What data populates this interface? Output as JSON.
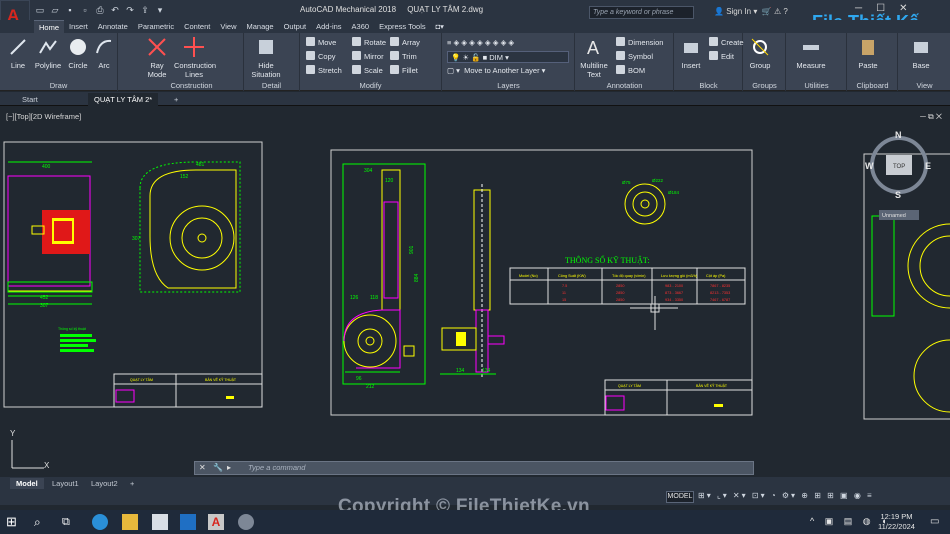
{
  "app": {
    "title": "AutoCAD Mechanical 2018",
    "file": "QUẠT LY TÂM 2.dwg",
    "search_placeholder": "Type a keyword or phrase",
    "signin": "Sign In",
    "brand": "File Thiết Kế .vn"
  },
  "ribbon_tabs": [
    "Home",
    "Insert",
    "Annotate",
    "Parametric",
    "Content",
    "View",
    "Manage",
    "Output",
    "Add-ins",
    "A360",
    "Express Tools"
  ],
  "ribbon": {
    "draw": {
      "label": "Draw",
      "line": "Line",
      "polyline": "Polyline",
      "circle": "Circle",
      "arc": "Arc"
    },
    "construction": {
      "label": "Construction",
      "ray_mode": "Ray Mode",
      "construction_lines": "Construction Lines"
    },
    "detail": {
      "label": "Detail",
      "hide_situation": "Hide Situation"
    },
    "modify": {
      "label": "Modify",
      "move": "Move",
      "rotate": "Rotate",
      "array": "Array",
      "copy": "Copy",
      "mirror": "Mirror",
      "trim": "Trim",
      "stretch": "Stretch",
      "scale": "Scale",
      "fillet": "Fillet"
    },
    "layers": {
      "label": "Layers",
      "current_layer": "DIM",
      "move_to_layer": "Move to Another Layer"
    },
    "annotation": {
      "label": "Annotation",
      "multiline_text": "Multiline Text",
      "dimension": "Dimension",
      "symbol": "Symbol",
      "bom": "BOM"
    },
    "block": {
      "label": "Block",
      "insert": "Insert",
      "create": "Create",
      "edit": "Edit"
    },
    "groups": {
      "label": "Groups",
      "group": "Group"
    },
    "utilities": {
      "label": "Utilities",
      "measure": "Measure"
    },
    "clipboard": {
      "label": "Clipboard",
      "paste": "Paste"
    },
    "view": {
      "label": "View",
      "base": "Base"
    }
  },
  "doc_tabs": [
    "Start",
    "QUẠT LY TÂM 2*",
    "+"
  ],
  "viewport": {
    "label": "[−][Top][2D Wireframe]",
    "compass": {
      "n": "N",
      "s": "S",
      "e": "E",
      "w": "W",
      "top": "TOP"
    },
    "ucs_name": "Unnamed"
  },
  "drawing": {
    "spec_title": "THÔNG SỐ KỸ THUẬT:",
    "table_headers": [
      "Model (No)",
      "Công Suất (KW)",
      "Tốc độ quay (v/min)",
      "Lưu lượng gió (m3/h)",
      "Cột áp (Pa)"
    ],
    "table_rows": [
      [
        "7.5",
        "7.5",
        "2850",
        "983 - 2100",
        "7867 - 8235"
      ],
      [
        "11",
        "11",
        "2850",
        "873 - 3667",
        "8213 - 7353"
      ],
      [
        "15",
        "15",
        "2850",
        "934 - 3350",
        "7467 - 6787"
      ]
    ],
    "dims_left": [
      "400",
      "481",
      "152",
      "384",
      "452",
      "307"
    ],
    "dims_mid": [
      "304",
      "120",
      "79",
      "126",
      "118",
      "96",
      "96",
      "212",
      "884",
      "901",
      "134",
      "134"
    ],
    "dims_circle": [
      "Ø75",
      "Ø222",
      "Ø184"
    ],
    "title_block": {
      "name": "QUẠT LY TÂM",
      "sheet": "BẢN VẼ KỸ THUẬT"
    },
    "left_note": "Thông số kỹ thuật"
  },
  "command": {
    "placeholder": "Type a command"
  },
  "layout_tabs": [
    "Model",
    "Layout1",
    "Layout2",
    "+"
  ],
  "status": {
    "model": "MODEL"
  },
  "taskbar": {
    "time": "12:19 PM",
    "date": "11/22/2024"
  },
  "watermark": "Copyright © FileThietKe.vn",
  "colors": {
    "ribbon": "#3b4453",
    "canvas": "#212830",
    "accent": "#d7261e",
    "cad_yellow": "#ffff00",
    "cad_magenta": "#ff00ff",
    "cad_green": "#00ff00",
    "cad_white": "#ffffff",
    "cad_cyan": "#00ffff",
    "cad_red": "#ff3030"
  }
}
